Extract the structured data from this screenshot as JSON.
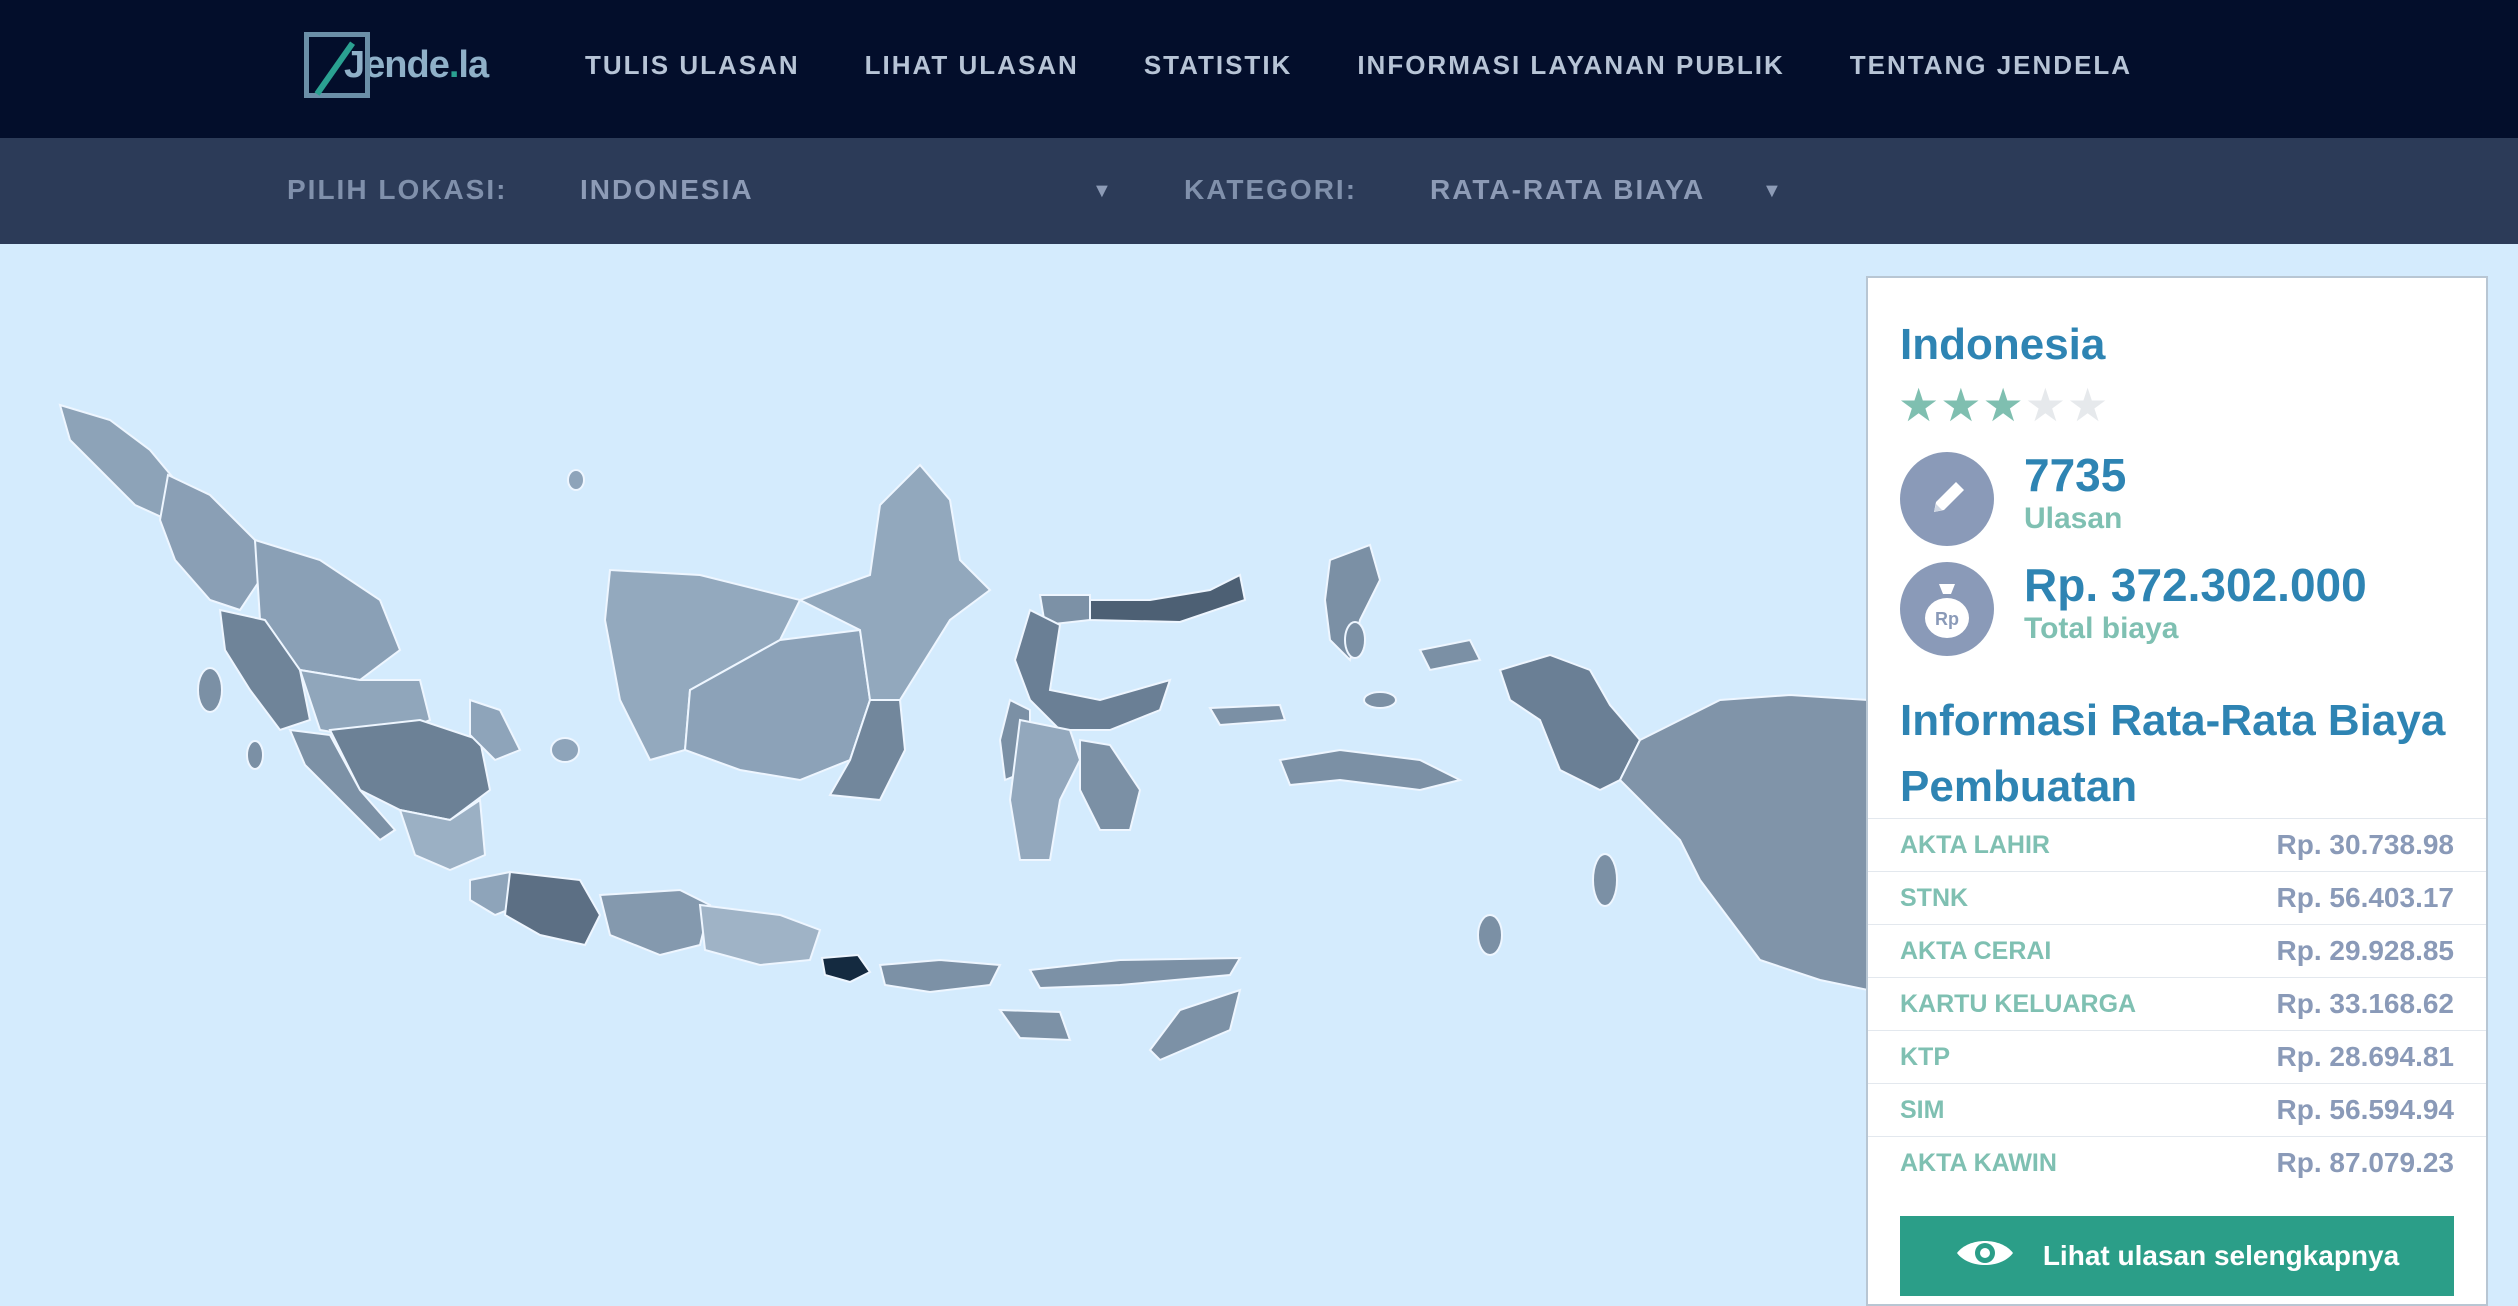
{
  "logo": {
    "text_main": "Jende",
    "text_dot": ".",
    "text_end": "la"
  },
  "nav": {
    "items": [
      {
        "label": "TULIS ULASAN"
      },
      {
        "label": "LIHAT ULASAN"
      },
      {
        "label": "STATISTIK"
      },
      {
        "label": "INFORMASI LAYANAN PUBLIK"
      },
      {
        "label": "TENTANG JENDELA"
      }
    ]
  },
  "filters": {
    "location_label": "PILIH LOKASI:",
    "location_value": "INDONESIA",
    "category_label": "KATEGORI:",
    "category_value": "RATA-RATA BIAYA",
    "caret_icon": "caret-down-icon"
  },
  "panel": {
    "title": "Indonesia",
    "rating": 3,
    "rating_max": 5,
    "reviews_count": "7735",
    "reviews_label": "Ulasan",
    "total_cost": "Rp. 372.302.000",
    "total_cost_label": "Total biaya",
    "section_title": "Informasi Rata-Rata Biaya Pembuatan",
    "costs": [
      {
        "name": "AKTA LAHIR",
        "value": "Rp. 30.738.98"
      },
      {
        "name": "STNK",
        "value": "Rp. 56.403.17"
      },
      {
        "name": "AKTA CERAI",
        "value": "Rp. 29.928.85"
      },
      {
        "name": "KARTU KELUARGA",
        "value": "Rp. 33.168.62"
      },
      {
        "name": "KTP",
        "value": "Rp. 28.694.81"
      },
      {
        "name": "SIM",
        "value": "Rp. 56.594.94"
      },
      {
        "name": "AKTA KAWIN",
        "value": "Rp. 87.079.23"
      }
    ],
    "cta_label": "Lihat ulasan selengkapnya"
  },
  "colors": {
    "nav_bg": "#030e2b",
    "filter_bg": "#2c3b58",
    "map_bg": "#d4ebfd",
    "accent": "#2e84b3",
    "teal": "#2b9e88",
    "star_on": "#7fbfb0",
    "star_off": "#e6e9ec"
  },
  "icons": [
    "pencil-icon",
    "money-bag-icon",
    "eye-icon",
    "star-icon",
    "caret-down-icon"
  ]
}
